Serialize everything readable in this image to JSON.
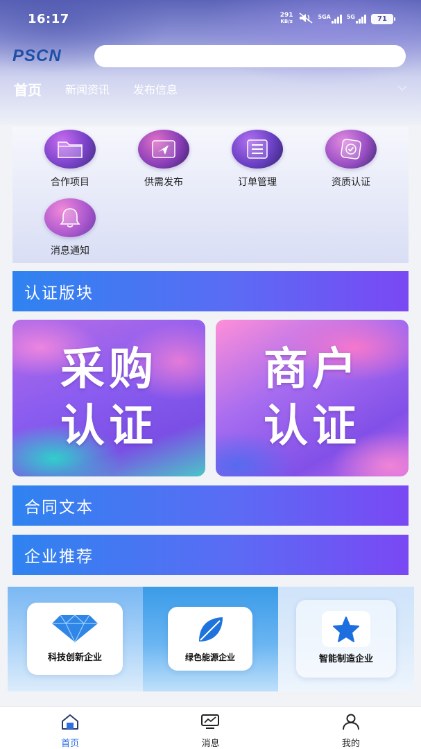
{
  "status_bar": {
    "time": "16:17",
    "net_speed_value": "291",
    "net_speed_unit": "KB/s",
    "sim1_label": "5GA",
    "sim2_label": "5G",
    "battery": "71"
  },
  "header": {
    "logo": "PSCN",
    "search_placeholder": ""
  },
  "nav_tabs": [
    {
      "label": "首页",
      "active": true
    },
    {
      "label": "新闻资讯",
      "active": false
    },
    {
      "label": "发布信息",
      "active": false
    }
  ],
  "quick_actions": [
    {
      "label": "合作项目",
      "icon": "folder-icon"
    },
    {
      "label": "供需发布",
      "icon": "send-icon"
    },
    {
      "label": "订单管理",
      "icon": "order-list-icon"
    },
    {
      "label": "资质认证",
      "icon": "certificate-icon"
    },
    {
      "label": "消息通知",
      "icon": "bell-icon"
    }
  ],
  "sections": {
    "certification": "认证版块",
    "contract": "合同文本",
    "enterprise": "企业推荐"
  },
  "cert_cards": [
    {
      "line1": "采购",
      "line2": "认证"
    },
    {
      "line1": "商户",
      "line2": "认证"
    }
  ],
  "recommended": [
    {
      "label": "科技创新企业",
      "icon": "diamond-icon"
    },
    {
      "label": "绿色能源企业",
      "icon": "leaf-icon"
    },
    {
      "label": "智能制造企业",
      "icon": "star-icon"
    }
  ],
  "bottom_nav": [
    {
      "label": "首页",
      "icon": "home-icon",
      "active": true
    },
    {
      "label": "消息",
      "icon": "monitor-chart-icon",
      "active": false
    },
    {
      "label": "我的",
      "icon": "user-icon",
      "active": false
    }
  ],
  "colors": {
    "accent": "#2b6fe0",
    "section_bar_start": "#2f83f0",
    "section_bar_end": "#7a48f4",
    "logo": "#1e4fa6"
  }
}
